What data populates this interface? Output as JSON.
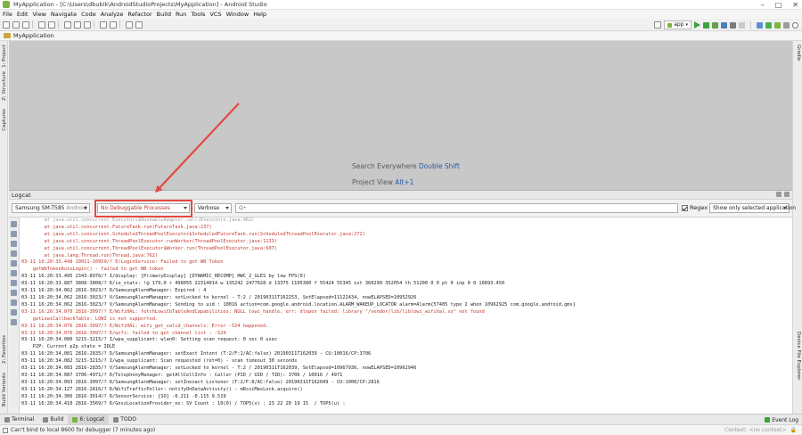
{
  "window": {
    "title": "MyApplication - [C:\\Users\\dbubik\\AndroidStudioProjects\\MyApplication] - Android Studio",
    "controls": [
      "–",
      "□",
      "✕"
    ]
  },
  "menu": [
    "File",
    "Edit",
    "View",
    "Navigate",
    "Code",
    "Analyze",
    "Refactor",
    "Build",
    "Run",
    "Tools",
    "VCS",
    "Window",
    "Help"
  ],
  "toolbar": {
    "run_config": "app"
  },
  "navbar": {
    "project": "MyApplication"
  },
  "side_tabs": {
    "left": [
      "1: Project",
      "Z: Structure",
      "Captures",
      "2: Favorites",
      "Build Variants"
    ],
    "right": [
      "Gradle",
      "Device File Explorer"
    ]
  },
  "editor": {
    "hint1_label": "Search Everywhere",
    "hint1_shortcut": "Double Shift",
    "hint2_label": "Project View",
    "hint2_shortcut": "Alt+1"
  },
  "logcat": {
    "title": "Logcat",
    "device": "Samsung SM-T585",
    "device_sub": "Android",
    "process": "No Debuggable Processes",
    "level": "Verbose",
    "search_placeholder": "Q•",
    "regex_label": "Regex",
    "filter": "Show only selected application",
    "lines": [
      {
        "t": "        at java.util.concurrent.Executors$RunnableAdapter.call(Executors.java:462)",
        "c": "dim"
      },
      {
        "t": "        at java.util.concurrent.FutureTask.run(FutureTask.java:237)",
        "c": "err"
      },
      {
        "t": "        at java.util.concurrent.ScheduledThreadPoolExecutor$ScheduledFutureTask.run(ScheduledThreadPoolExecutor.java:272)",
        "c": "err"
      },
      {
        "t": "        at java.util.concurrent.ThreadPoolExecutor.runWorker(ThreadPoolExecutor.java:1133)",
        "c": "err"
      },
      {
        "t": "        at java.util.concurrent.ThreadPoolExecutor$Worker.run(ThreadPoolExecutor.java:607)",
        "c": "err"
      },
      {
        "t": "        at java.lang.Thread.run(Thread.java:762)",
        "c": "err"
      },
      {
        "t": "03-11 16:20:33.448 10011-10959/? E/LoginService: Failed to get WB Token",
        "c": "err"
      },
      {
        "t": "    getWbTokenAutoLogin() - failed to get WB token",
        "c": "err"
      },
      {
        "t": "03-11 16:20:33.495 2343-8976/? I/display: [PrimaryDisplay] [DYNAMIC_RECOMP] HWC_2_GLES by low FPS(0)",
        "c": "info"
      },
      {
        "t": "03-11 16:20:33.887 3808-3808/? D/io_stats: !@ 179,0 r 498055 22314014 w 135242 2477028 d 13375 1105380 f 55424 55345 iot 360290 352054 th 51200 0 0 pt 0 inp 0 0 10893.450",
        "c": "info"
      },
      {
        "t": "03-11 16:20:34.062 2816-3023/? D/SamsungAlarmManager: Expired : 4",
        "c": "info"
      },
      {
        "t": "03-11 16:20:34.062 2816-3023/? V/SamsungAlarmManager: setLocked to kernel - T:2 / 20190311T162253, SetElapsed=11122434, nowELAPSED=10952926",
        "c": "info"
      },
      {
        "t": "03-11 16:20:34.062 2816-3023/? V/SamsungAlarmManager: Sending to uid : 10016 action=com.google.android.location.ALARM_WAKEUP_LOCATOR alarm=Alarm{57405 type 2 when 10962925 com.google.android.gms}",
        "c": "info"
      },
      {
        "t": "03-11 16:20:34.070 2816-3097/? E/WifiHAL: fetchLowiCbTableAndCapabilities: NULL lowi_handle, err: dlopen failed: library \"/vendor/lib/liblowi_wifihal.so\" not found",
        "c": "err"
      },
      {
        "t": "    getLowiCallbackTable: LOWI is not supported.",
        "c": "err"
      },
      {
        "t": "03-11 16:20:34.076 2816-3097/? E/WifiHAL: wifi_get_valid_channels: Error -524 happened.",
        "c": "err"
      },
      {
        "t": "03-11 16:20:34.076 2816-3097/? E/wifi: failed to get channel list : -524",
        "c": "err"
      },
      {
        "t": "03-11 16:20:34.080 3215-3215/? I/wpa_supplicant: wlan0: Setting scan request: 0 sec 0 usec",
        "c": "info"
      },
      {
        "t": "    P2P: Current p2p state = IDLE",
        "c": "info"
      },
      {
        "t": "03-11 16:20:34.081 2816-2835/? D/SamsungAlarmManager: setExact Intent (T:2/F:1/AC:false) 20190311T162039 - CU:10016/CP:3706",
        "c": "info"
      },
      {
        "t": "03-11 16:20:34.082 3215-3215/? I/wpa_supplicant: Scan requested (ret=0) - scan timeout 30 seconds",
        "c": "info"
      },
      {
        "t": "03-11 16:20:34.083 2816-2835/? V/SamsungAlarmManager: setLocked to kernel - T:2 / 20190311T162039, SetElapsed=10967936, nowELAPSED=10962946",
        "c": "info"
      },
      {
        "t": "03-11 16:20:34.087 3706-4971/? D/TelephonyManager: getAllCellInfo : Caller (PID / UID / TID): 3706 / 10016 / 4971",
        "c": "info"
      },
      {
        "t": "03-11 16:20:34.093 2816-3097/? D/SamsungAlarmManager: setInexact Listener (T:2/F:8/AC:false) 20190311T162049 - CU:1000/CP:2816",
        "c": "info"
      },
      {
        "t": "03-11 16:20:34.127 2816-2816/? D/WifiTrafficPoller: notifyOnDataActivity() - mRssiMaxLock.acquire()",
        "c": "info"
      },
      {
        "t": "03-11 16:20:34.306 2816-3014/? D/SensorService: [SO] -0.211 -0.115 9.519",
        "c": "info"
      },
      {
        "t": "03-11 16:20:34.410 2816-3569/? D/GnssLocationProvider_ex: SV Count : 10(0) / TOP5(v) : 23 22 20 19 15  / TOP5(u) :",
        "c": "info"
      }
    ]
  },
  "bottom_tabs": [
    "Terminal",
    "Build",
    "6: Logcat",
    "TODO"
  ],
  "event_log": "Event Log",
  "status": {
    "text": "Can't bind to local 8600 for debugger (7 minutes ago)",
    "right": "Context: <no context>"
  }
}
